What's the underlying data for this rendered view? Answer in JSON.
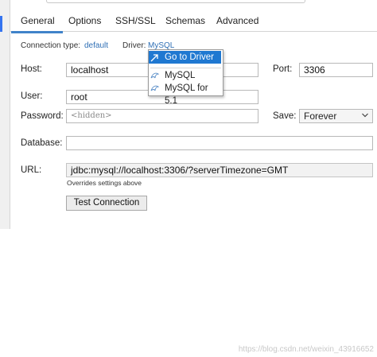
{
  "tabs": [
    {
      "label": "General",
      "active": true
    },
    {
      "label": "Options",
      "active": false
    },
    {
      "label": "SSH/SSL",
      "active": false
    },
    {
      "label": "Schemas",
      "active": false
    },
    {
      "label": "Advanced",
      "active": false
    }
  ],
  "connection": {
    "type_label": "Connection type:",
    "type_value": "default",
    "driver_label": "Driver:",
    "driver_value": "MySQL"
  },
  "driver_menu": {
    "goto_label": "Go to Driver",
    "options": [
      "MySQL",
      "MySQL for 5.1"
    ]
  },
  "form": {
    "host_label": "Host:",
    "host_value": "localhost",
    "port_label": "Port:",
    "port_value": "3306",
    "user_label": "User:",
    "user_value": "root",
    "password_label": "Password:",
    "password_placeholder": "<hidden>",
    "save_label": "Save:",
    "save_value": "Forever",
    "database_label": "Database:",
    "database_value": "",
    "url_label": "URL:",
    "url_value": "jdbc:mysql://localhost:3306/?serverTimezone=GMT",
    "url_hint": "Overrides settings above",
    "test_button": "Test Connection"
  },
  "watermark": "https://blog.csdn.net/weixin_43916652",
  "colors": {
    "accent": "#3574f0",
    "link": "#2f6fb5",
    "menu_highlight": "#1f78d1"
  }
}
